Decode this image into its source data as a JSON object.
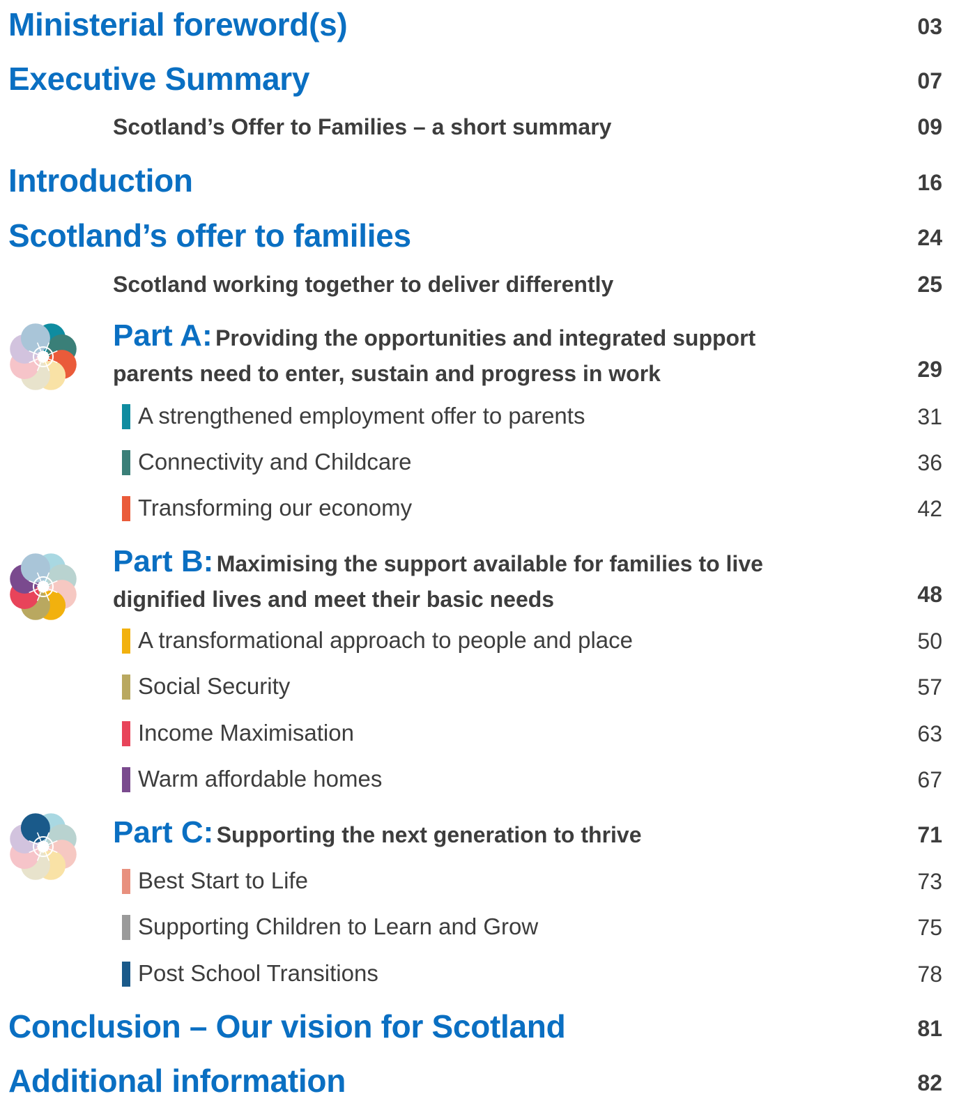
{
  "contents": {
    "ministerial": {
      "title": "Ministerial foreword(s)",
      "page": "03"
    },
    "executive": {
      "title": "Executive Summary",
      "page": "07"
    },
    "offer_summary": {
      "title": "Scotland’s Offer to Families – a short summary",
      "page": "09"
    },
    "introduction": {
      "title": "Introduction",
      "page": "16"
    },
    "offer": {
      "title": "Scotland’s offer to families",
      "page": "24"
    },
    "working_together": {
      "title": "Scotland working together to deliver differently",
      "page": "25"
    },
    "part_a": {
      "label": "Part A:",
      "line1": "Providing the opportunities and integrated support",
      "line2": "parents need to enter, sustain and progress in work",
      "page": "29",
      "items": [
        {
          "title": "A strengthened employment offer to parents",
          "page": "31",
          "color": "#0f8ca0"
        },
        {
          "title": "Connectivity and Childcare",
          "page": "36",
          "color": "#3a7f78"
        },
        {
          "title": "Transforming our economy",
          "page": "42",
          "color": "#ea5b3a"
        }
      ]
    },
    "part_b": {
      "label": "Part B:",
      "line1": "Maximising the support available for families to live",
      "line2": "dignified lives and meet their basic needs",
      "page": "48",
      "items": [
        {
          "title": "A transformational approach to people and place",
          "page": "50",
          "color": "#f2b10e"
        },
        {
          "title": "Social Security",
          "page": "57",
          "color": "#b9a860"
        },
        {
          "title": "Income Maximisation",
          "page": "63",
          "color": "#e8445a"
        },
        {
          "title": "Warm affordable homes",
          "page": "67",
          "color": "#7a4a8e"
        }
      ]
    },
    "part_c": {
      "label": "Part C:",
      "line1": "Supporting the next generation to thrive",
      "page": "71",
      "items": [
        {
          "title": "Best Start to Life",
          "page": "73",
          "color": "#e8907e"
        },
        {
          "title": "Supporting Children to Learn and Grow",
          "page": "75",
          "color": "#9a9a9a"
        },
        {
          "title": "Post School Transitions",
          "page": "78",
          "color": "#1a5a8a"
        }
      ]
    },
    "conclusion": {
      "title": "Conclusion – Our vision for Scotland",
      "page": "81"
    },
    "additional": {
      "title": "Additional information",
      "page": "82"
    }
  },
  "flowers": {
    "a": [
      "#0f8ca0",
      "#3a7f78",
      "#ea5b3a",
      "#f9e2a6",
      "#e8e3cc",
      "#f6c4c9",
      "#d2c3de",
      "#a9c5d8"
    ],
    "b": [
      "#a9d8e2",
      "#b9d3d0",
      "#f6c8c2",
      "#f2b10e",
      "#b9a860",
      "#e8445a",
      "#7a4a8e",
      "#a9c5d8"
    ],
    "c": [
      "#a9d8e2",
      "#b9d3d0",
      "#f6c8c2",
      "#f9e2a6",
      "#e8e3cc",
      "#f6c4c9",
      "#d2c3de",
      "#1a5a8a"
    ]
  }
}
